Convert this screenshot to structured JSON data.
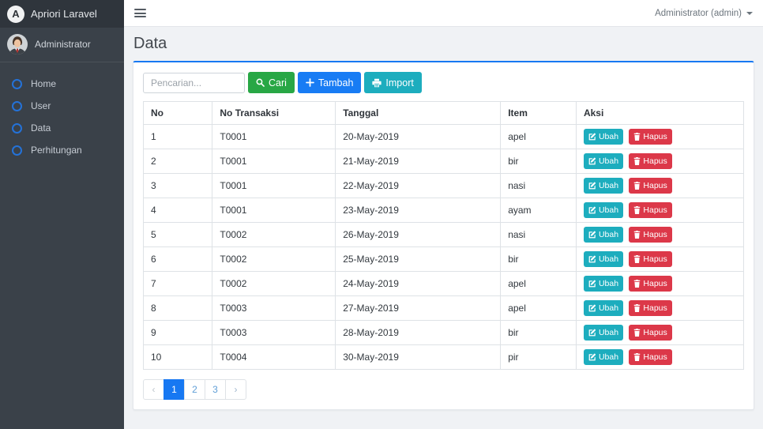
{
  "brand": {
    "title": "Apriori Laravel",
    "logo_letter": "A"
  },
  "user_panel": {
    "name": "Administrator"
  },
  "sidebar": {
    "items": [
      {
        "label": "Home"
      },
      {
        "label": "User"
      },
      {
        "label": "Data"
      },
      {
        "label": "Perhitungan"
      }
    ]
  },
  "topbar": {
    "user_menu": "Administrator (admin)"
  },
  "page": {
    "title": "Data"
  },
  "toolbar": {
    "search_placeholder": "Pencarian...",
    "cari_label": "Cari",
    "tambah_label": "Tambah",
    "import_label": "Import"
  },
  "table": {
    "headers": [
      "No",
      "No Transaksi",
      "Tanggal",
      "Item",
      "Aksi"
    ],
    "action_labels": {
      "ubah": "Ubah",
      "hapus": "Hapus"
    },
    "rows": [
      {
        "no": "1",
        "no_transaksi": "T0001",
        "tanggal": "20-May-2019",
        "item": "apel"
      },
      {
        "no": "2",
        "no_transaksi": "T0001",
        "tanggal": "21-May-2019",
        "item": "bir"
      },
      {
        "no": "3",
        "no_transaksi": "T0001",
        "tanggal": "22-May-2019",
        "item": "nasi"
      },
      {
        "no": "4",
        "no_transaksi": "T0001",
        "tanggal": "23-May-2019",
        "item": "ayam"
      },
      {
        "no": "5",
        "no_transaksi": "T0002",
        "tanggal": "26-May-2019",
        "item": "nasi"
      },
      {
        "no": "6",
        "no_transaksi": "T0002",
        "tanggal": "25-May-2019",
        "item": "bir"
      },
      {
        "no": "7",
        "no_transaksi": "T0002",
        "tanggal": "24-May-2019",
        "item": "apel"
      },
      {
        "no": "8",
        "no_transaksi": "T0003",
        "tanggal": "27-May-2019",
        "item": "apel"
      },
      {
        "no": "9",
        "no_transaksi": "T0003",
        "tanggal": "28-May-2019",
        "item": "bir"
      },
      {
        "no": "10",
        "no_transaksi": "T0004",
        "tanggal": "30-May-2019",
        "item": "pir"
      }
    ]
  },
  "pagination": {
    "prev": "‹",
    "pages": [
      "1",
      "2",
      "3"
    ],
    "next": "›",
    "active": "1"
  },
  "colors": {
    "card_accent": "#1778f2",
    "cari_button": "#28a745",
    "tambah_button": "#187cf4",
    "import_button": "#1dadbe",
    "ubah_button": "#1dadbe",
    "hapus_button": "#dc3849",
    "sidebar_bg": "#3a4149",
    "brand_bg": "#2f353c",
    "menu_circle_icon": "#2472d8"
  }
}
